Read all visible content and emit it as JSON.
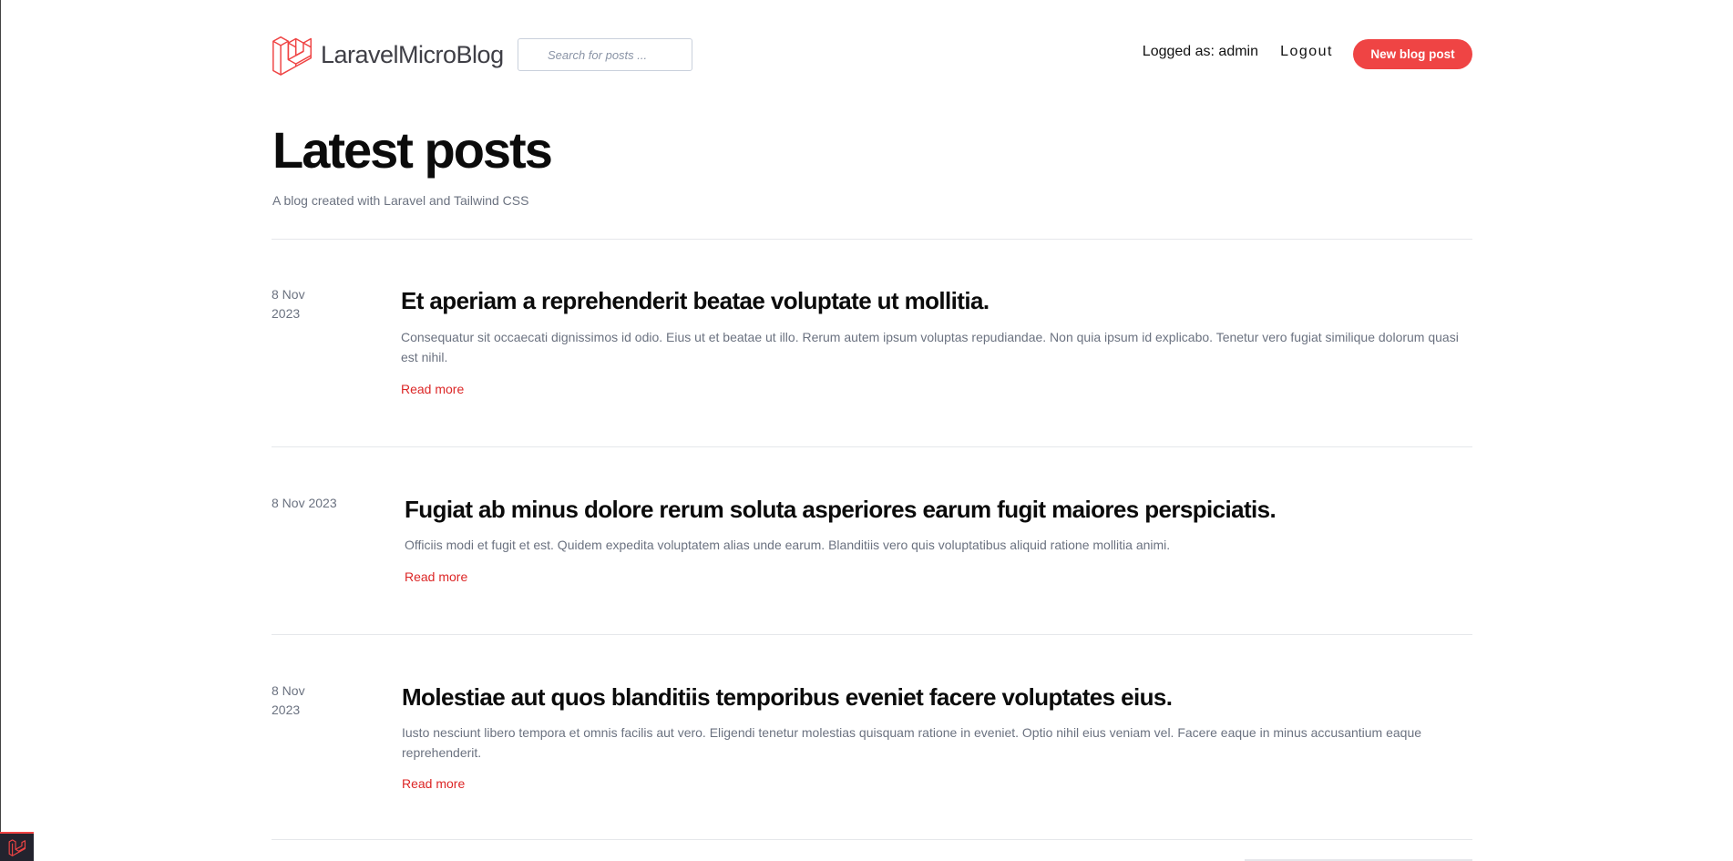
{
  "brand": {
    "name": "LaravelMicroBlog"
  },
  "search": {
    "placeholder": "Search for posts ..."
  },
  "nav": {
    "logged_as": "Logged as: admin",
    "logout": "Logout",
    "new_post": "New blog post"
  },
  "hero": {
    "title": "Latest posts",
    "subtitle": "A blog created with Laravel and Tailwind CSS"
  },
  "posts": [
    {
      "date_line1": "8 Nov",
      "date_line2": "2023",
      "title": "Et aperiam a reprehenderit beatae voluptate ut mollitia.",
      "excerpt": "Consequatur sit occaecati dignissimos id odio. Eius ut et beatae ut illo. Rerum autem ipsum voluptas repudiandae. Non quia ipsum id explicabo. Tenetur vero fugiat similique dolorum quasi est nihil.",
      "read_more": "Read more"
    },
    {
      "date": "8 Nov 2023",
      "title": "Fugiat ab minus dolore rerum soluta asperiores earum fugit maiores perspiciatis.",
      "excerpt": "Officiis modi et fugit et est. Quidem expedita voluptatem alias unde earum. Blanditiis vero quis voluptatibus aliquid ratione mollitia animi.",
      "read_more": "Read more"
    },
    {
      "date_line1": "8 Nov",
      "date_line2": "2023",
      "title": "Molestiae aut quos blanditiis temporibus eveniet facere voluptates eius.",
      "excerpt": "Iusto nesciunt libero tempora et omnis facilis aut vero. Eligendi tenetur molestias quisquam ratione in eveniet. Optio nihil eius veniam vel. Facere eaque in minus accusantium eaque reprehenderit.",
      "read_more": "Read more"
    }
  ],
  "colors": {
    "accent": "#ef4444",
    "link": "#dc2626",
    "muted": "#6b7280"
  },
  "icons": {
    "logo": "laravel-logo-icon",
    "corner": "laravel-badge-icon"
  }
}
